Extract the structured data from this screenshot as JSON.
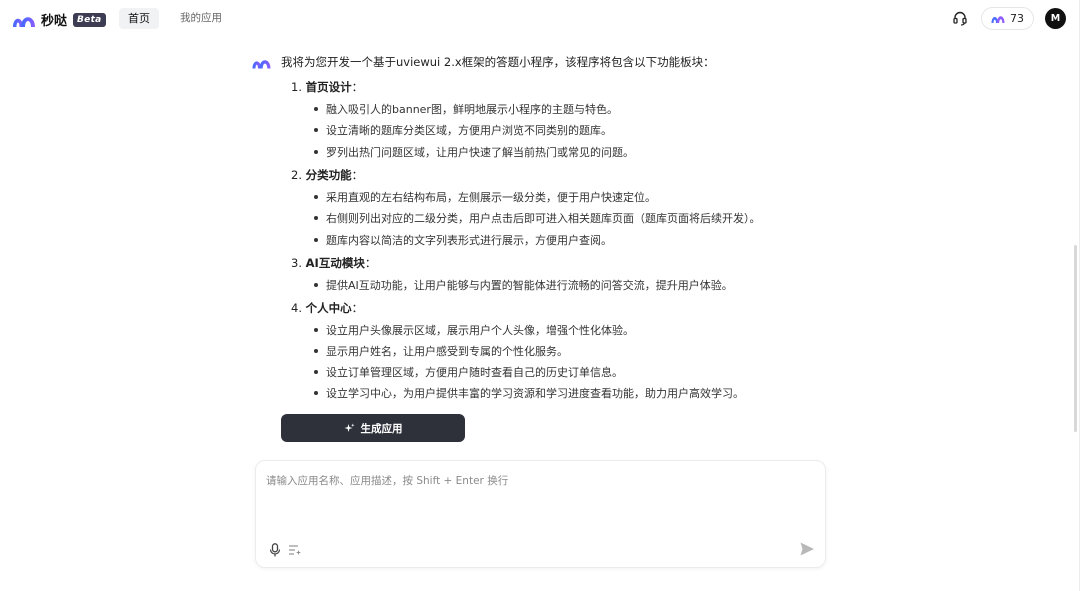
{
  "header": {
    "app_name": "秒哒",
    "beta": "Beta",
    "nav_home": "首页",
    "nav_apps": "我的应用",
    "credits": "73",
    "avatar": "M"
  },
  "chat": {
    "intro": "我将为您开发一个基于uviewui 2.x框架的答题小程序，该程序将包含以下功能板块：",
    "sections": [
      {
        "num": "1.",
        "title": "首页设计",
        "colon": "：",
        "bullets": [
          "融入吸引人的banner图，鲜明地展示小程序的主题与特色。",
          "设立清晰的题库分类区域，方便用户浏览不同类别的题库。",
          "罗列出热门问题区域，让用户快速了解当前热门或常见的问题。"
        ]
      },
      {
        "num": "2.",
        "title": "分类功能",
        "colon": "：",
        "bullets": [
          "采用直观的左右结构布局，左侧展示一级分类，便于用户快速定位。",
          "右侧则列出对应的二级分类，用户点击后即可进入相关题库页面（题库页面将后续开发）。",
          "题库内容以简洁的文字列表形式进行展示，方便用户查阅。"
        ]
      },
      {
        "num": "3.",
        "title": "AI互动模块",
        "colon": "：",
        "bullets": [
          "提供AI互动功能，让用户能够与内置的智能体进行流畅的问答交流，提升用户体验。"
        ]
      },
      {
        "num": "4.",
        "title": "个人中心",
        "colon": "：",
        "bullets": [
          "设立用户头像展示区域，展示用户个人头像，增强个性化体验。",
          "显示用户姓名，让用户感受到专属的个性化服务。",
          "设立订单管理区域，方便用户随时查看自己的历史订单信息。",
          "设立学习中心，为用户提供丰富的学习资源和学习进度查看功能，助力用户高效学习。"
        ]
      }
    ],
    "generate_label": "生成应用"
  },
  "composer": {
    "placeholder": "请输入应用名称、应用描述，按 Shift + Enter 换行",
    "value": ""
  },
  "icons": {
    "logo": "brand-arch-icon",
    "support": "headset-icon",
    "credits": "brand-m-icon",
    "generate": "sparkle-icon",
    "voice": "microphone-icon",
    "prompt": "prompt-list-icon",
    "send": "send-icon"
  },
  "colors": {
    "brand_blue": "#3d6bff",
    "brand_purple": "#8f5cff",
    "dark_button": "#2e313a"
  }
}
